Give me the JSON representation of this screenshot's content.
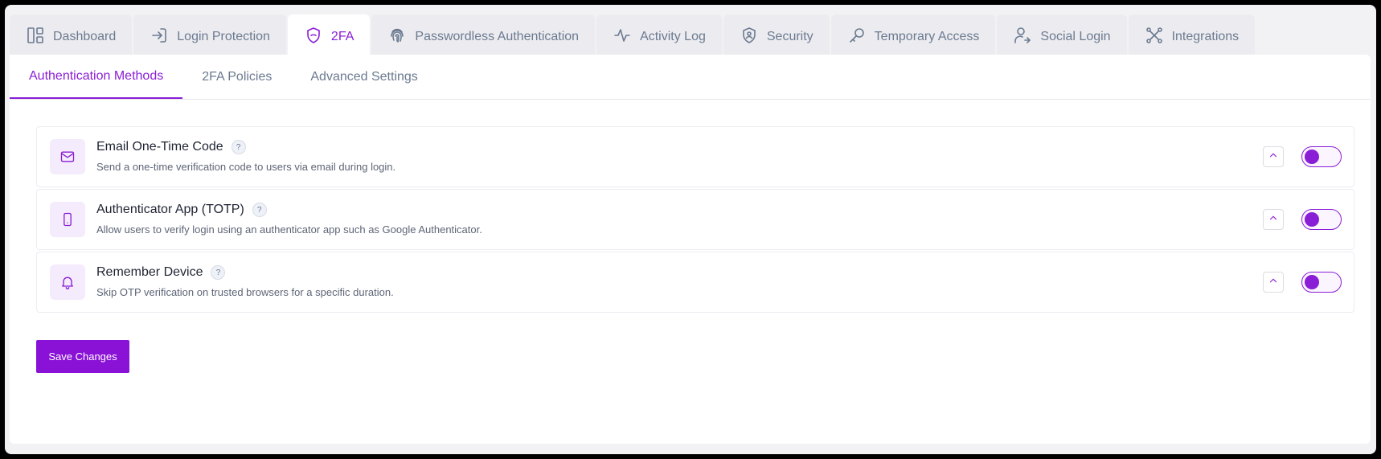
{
  "top_tabs": [
    {
      "label": "Dashboard",
      "icon": "layout-dashboard-icon",
      "active": false
    },
    {
      "label": "Login Protection",
      "icon": "login-icon",
      "active": false
    },
    {
      "label": "2FA",
      "icon": "shield-icon",
      "active": true
    },
    {
      "label": "Passwordless Authentication",
      "icon": "fingerprint-icon",
      "active": false
    },
    {
      "label": "Activity Log",
      "icon": "activity-icon",
      "active": false
    },
    {
      "label": "Security",
      "icon": "shield-user-icon",
      "active": false
    },
    {
      "label": "Temporary Access",
      "icon": "key-icon",
      "active": false
    },
    {
      "label": "Social Login",
      "icon": "user-link-icon",
      "active": false
    },
    {
      "label": "Integrations",
      "icon": "integrations-icon",
      "active": false
    }
  ],
  "sub_tabs": [
    {
      "label": "Authentication Methods",
      "active": true
    },
    {
      "label": "2FA Policies",
      "active": false
    },
    {
      "label": "Advanced Settings",
      "active": false
    }
  ],
  "methods": [
    {
      "title": "Email One-Time Code",
      "description": "Send a one-time verification code to users via email during login.",
      "icon": "mail-icon",
      "help": "?",
      "enabled": true
    },
    {
      "title": "Authenticator App (TOTP)",
      "description": "Allow users to verify login using an authenticator app such as Google Authenticator.",
      "icon": "smartphone-icon",
      "help": "?",
      "enabled": true
    },
    {
      "title": "Remember Device",
      "description": "Skip OTP verification on trusted browsers for a specific duration.",
      "icon": "bell-icon",
      "help": "?",
      "enabled": true
    }
  ],
  "save_button": {
    "label": "Save Changes"
  },
  "colors": {
    "accent": "#8a1ed6",
    "muted": "#6b7a90",
    "background": "#f2f2f5"
  }
}
